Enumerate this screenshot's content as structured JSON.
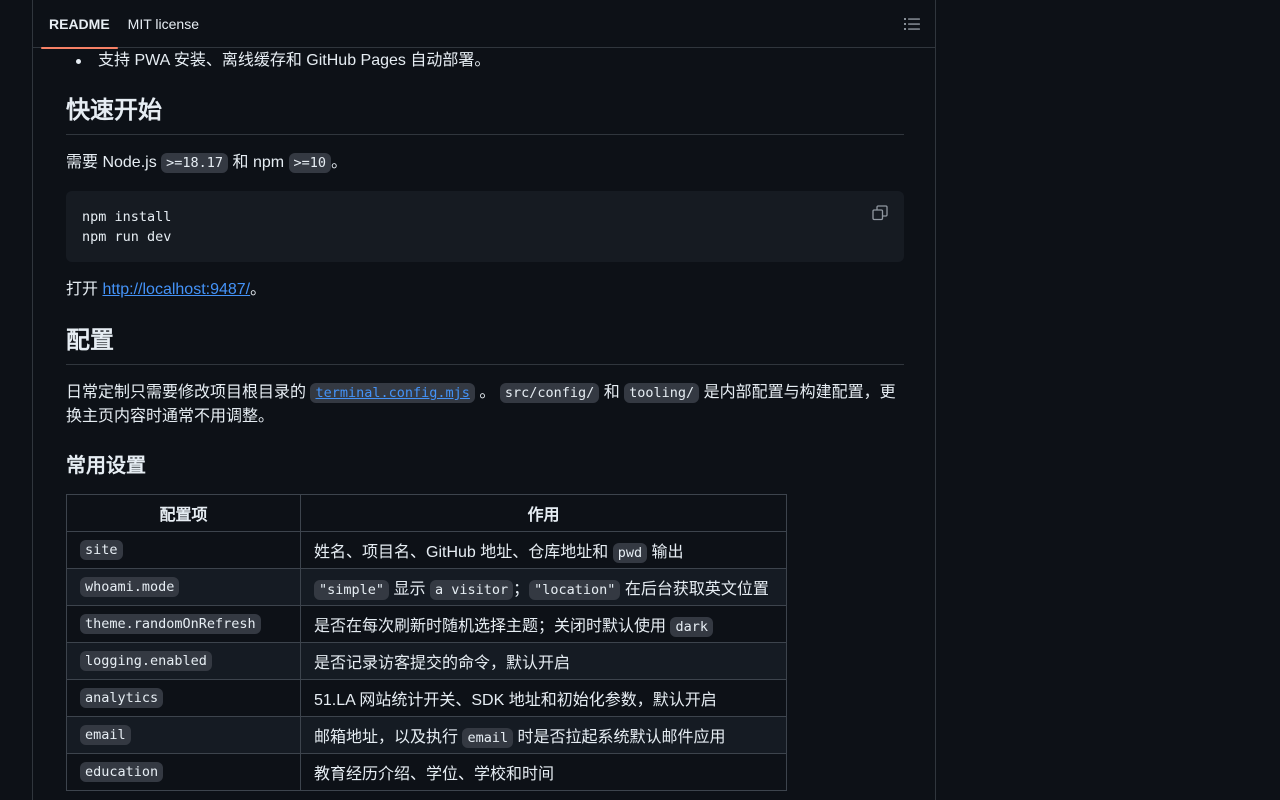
{
  "tabs": [
    {
      "label": "README",
      "active": true
    },
    {
      "label": "MIT license",
      "active": false
    }
  ],
  "toc_icon": "list-unordered-icon",
  "intro_bullet": "支持 PWA 安装、离线缓存和 GitHub Pages 自动部署。",
  "quickstart": {
    "heading": "快速开始",
    "requirement": {
      "prefix": "需要 Node.js",
      "node_version": ">=18.17",
      "middle": "和 npm",
      "npm_version": ">=10",
      "suffix": "。"
    },
    "code_lines": [
      "npm install",
      "npm run dev"
    ],
    "copy_icon": "copy-icon",
    "open": {
      "prefix": "打开",
      "link": "http://localhost:9487/",
      "suffix": "。"
    }
  },
  "config": {
    "heading": "配置",
    "description": {
      "prefix": "日常定制只需要修改项目根目录的",
      "file_link": "terminal.config.mjs",
      "sep1": "。",
      "dir1": "src/config/",
      "and": "和",
      "dir2": "tooling/",
      "suffix": "是内部配置与构建配置，更换主页内容时通常不用调整。"
    },
    "common_heading": "常用设置",
    "table": {
      "headers": [
        "配置项",
        "作用"
      ],
      "rows": [
        {
          "key": "site",
          "parts": [
            {
              "t": "姓名、项目名、GitHub 地址、仓库地址和 "
            },
            {
              "c": "pwd"
            },
            {
              "t": " 输出"
            }
          ]
        },
        {
          "key": "whoami.mode",
          "parts": [
            {
              "c": "\"simple\""
            },
            {
              "t": " 显示 "
            },
            {
              "c": "a visitor"
            },
            {
              "t": "；"
            },
            {
              "c": "\"location\""
            },
            {
              "t": " 在后台获取英文位置"
            }
          ]
        },
        {
          "key": "theme.randomOnRefresh",
          "parts": [
            {
              "t": "是否在每次刷新时随机选择主题；关闭时默认使用 "
            },
            {
              "c": "dark"
            }
          ]
        },
        {
          "key": "logging.enabled",
          "parts": [
            {
              "t": "是否记录访客提交的命令，默认开启"
            }
          ]
        },
        {
          "key": "analytics",
          "parts": [
            {
              "t": "51.LA 网站统计开关、SDK 地址和初始化参数，默认开启"
            }
          ]
        },
        {
          "key": "email",
          "parts": [
            {
              "t": "邮箱地址，以及执行 "
            },
            {
              "c": "email"
            },
            {
              "t": " 时是否拉起系统默认邮件应用"
            }
          ]
        },
        {
          "key": "education",
          "parts": [
            {
              "t": "教育经历介绍、学位、学校和时间"
            }
          ]
        }
      ]
    }
  }
}
